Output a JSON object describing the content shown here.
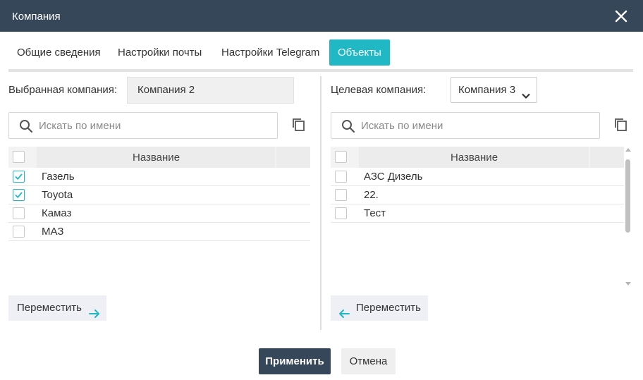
{
  "dialog": {
    "title": "Компания"
  },
  "tabs": [
    {
      "label": "Общие сведения",
      "active": false
    },
    {
      "label": "Настройки почты",
      "active": false
    },
    {
      "label": "Настройки Telegram",
      "active": false
    },
    {
      "label": "Объекты",
      "active": true
    }
  ],
  "left": {
    "company_label": "Выбранная компания:",
    "company_value": "Компания 2",
    "search_placeholder": "Искать по имени",
    "column_header": "Название",
    "rows": [
      {
        "name": "Газель",
        "checked": true
      },
      {
        "name": "Toyota",
        "checked": true
      },
      {
        "name": "Камаз",
        "checked": false
      },
      {
        "name": "МАЗ",
        "checked": false
      }
    ],
    "move_label": "Переместить"
  },
  "right": {
    "company_label": "Целевая компания:",
    "company_value": "Компания 3",
    "search_placeholder": "Искать по имени",
    "column_header": "Название",
    "rows": [
      {
        "name": "АЗС Дизель",
        "checked": false
      },
      {
        "name": "22.",
        "checked": false
      },
      {
        "name": "Тест",
        "checked": false
      }
    ],
    "move_label": "Переместить"
  },
  "footer": {
    "apply_label": "Применить",
    "cancel_label": "Отмена"
  },
  "colors": {
    "header_bg": "#37475a",
    "accent": "#1fb8c4",
    "apply_bg": "#37475a"
  },
  "icons": [
    "close-icon",
    "search-icon",
    "copy-icon",
    "chevron-down-icon",
    "arrow-right-icon",
    "arrow-left-icon",
    "check-icon"
  ]
}
